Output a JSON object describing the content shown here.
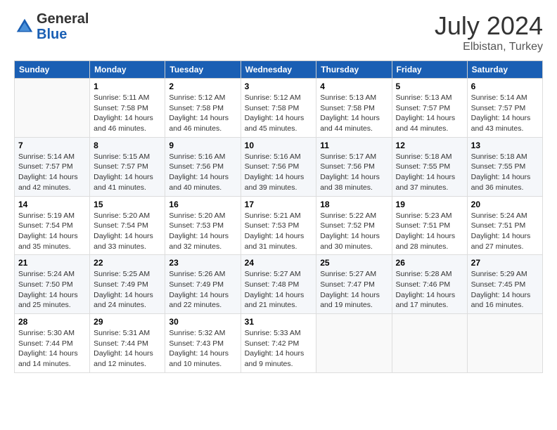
{
  "header": {
    "logo_general": "General",
    "logo_blue": "Blue",
    "month_year": "July 2024",
    "location": "Elbistan, Turkey"
  },
  "days_of_week": [
    "Sunday",
    "Monday",
    "Tuesday",
    "Wednesday",
    "Thursday",
    "Friday",
    "Saturday"
  ],
  "weeks": [
    [
      {
        "day": "",
        "info": ""
      },
      {
        "day": "1",
        "info": "Sunrise: 5:11 AM\nSunset: 7:58 PM\nDaylight: 14 hours\nand 46 minutes."
      },
      {
        "day": "2",
        "info": "Sunrise: 5:12 AM\nSunset: 7:58 PM\nDaylight: 14 hours\nand 46 minutes."
      },
      {
        "day": "3",
        "info": "Sunrise: 5:12 AM\nSunset: 7:58 PM\nDaylight: 14 hours\nand 45 minutes."
      },
      {
        "day": "4",
        "info": "Sunrise: 5:13 AM\nSunset: 7:58 PM\nDaylight: 14 hours\nand 44 minutes."
      },
      {
        "day": "5",
        "info": "Sunrise: 5:13 AM\nSunset: 7:57 PM\nDaylight: 14 hours\nand 44 minutes."
      },
      {
        "day": "6",
        "info": "Sunrise: 5:14 AM\nSunset: 7:57 PM\nDaylight: 14 hours\nand 43 minutes."
      }
    ],
    [
      {
        "day": "7",
        "info": "Sunrise: 5:14 AM\nSunset: 7:57 PM\nDaylight: 14 hours\nand 42 minutes."
      },
      {
        "day": "8",
        "info": "Sunrise: 5:15 AM\nSunset: 7:57 PM\nDaylight: 14 hours\nand 41 minutes."
      },
      {
        "day": "9",
        "info": "Sunrise: 5:16 AM\nSunset: 7:56 PM\nDaylight: 14 hours\nand 40 minutes."
      },
      {
        "day": "10",
        "info": "Sunrise: 5:16 AM\nSunset: 7:56 PM\nDaylight: 14 hours\nand 39 minutes."
      },
      {
        "day": "11",
        "info": "Sunrise: 5:17 AM\nSunset: 7:56 PM\nDaylight: 14 hours\nand 38 minutes."
      },
      {
        "day": "12",
        "info": "Sunrise: 5:18 AM\nSunset: 7:55 PM\nDaylight: 14 hours\nand 37 minutes."
      },
      {
        "day": "13",
        "info": "Sunrise: 5:18 AM\nSunset: 7:55 PM\nDaylight: 14 hours\nand 36 minutes."
      }
    ],
    [
      {
        "day": "14",
        "info": "Sunrise: 5:19 AM\nSunset: 7:54 PM\nDaylight: 14 hours\nand 35 minutes."
      },
      {
        "day": "15",
        "info": "Sunrise: 5:20 AM\nSunset: 7:54 PM\nDaylight: 14 hours\nand 33 minutes."
      },
      {
        "day": "16",
        "info": "Sunrise: 5:20 AM\nSunset: 7:53 PM\nDaylight: 14 hours\nand 32 minutes."
      },
      {
        "day": "17",
        "info": "Sunrise: 5:21 AM\nSunset: 7:53 PM\nDaylight: 14 hours\nand 31 minutes."
      },
      {
        "day": "18",
        "info": "Sunrise: 5:22 AM\nSunset: 7:52 PM\nDaylight: 14 hours\nand 30 minutes."
      },
      {
        "day": "19",
        "info": "Sunrise: 5:23 AM\nSunset: 7:51 PM\nDaylight: 14 hours\nand 28 minutes."
      },
      {
        "day": "20",
        "info": "Sunrise: 5:24 AM\nSunset: 7:51 PM\nDaylight: 14 hours\nand 27 minutes."
      }
    ],
    [
      {
        "day": "21",
        "info": "Sunrise: 5:24 AM\nSunset: 7:50 PM\nDaylight: 14 hours\nand 25 minutes."
      },
      {
        "day": "22",
        "info": "Sunrise: 5:25 AM\nSunset: 7:49 PM\nDaylight: 14 hours\nand 24 minutes."
      },
      {
        "day": "23",
        "info": "Sunrise: 5:26 AM\nSunset: 7:49 PM\nDaylight: 14 hours\nand 22 minutes."
      },
      {
        "day": "24",
        "info": "Sunrise: 5:27 AM\nSunset: 7:48 PM\nDaylight: 14 hours\nand 21 minutes."
      },
      {
        "day": "25",
        "info": "Sunrise: 5:27 AM\nSunset: 7:47 PM\nDaylight: 14 hours\nand 19 minutes."
      },
      {
        "day": "26",
        "info": "Sunrise: 5:28 AM\nSunset: 7:46 PM\nDaylight: 14 hours\nand 17 minutes."
      },
      {
        "day": "27",
        "info": "Sunrise: 5:29 AM\nSunset: 7:45 PM\nDaylight: 14 hours\nand 16 minutes."
      }
    ],
    [
      {
        "day": "28",
        "info": "Sunrise: 5:30 AM\nSunset: 7:44 PM\nDaylight: 14 hours\nand 14 minutes."
      },
      {
        "day": "29",
        "info": "Sunrise: 5:31 AM\nSunset: 7:44 PM\nDaylight: 14 hours\nand 12 minutes."
      },
      {
        "day": "30",
        "info": "Sunrise: 5:32 AM\nSunset: 7:43 PM\nDaylight: 14 hours\nand 10 minutes."
      },
      {
        "day": "31",
        "info": "Sunrise: 5:33 AM\nSunset: 7:42 PM\nDaylight: 14 hours\nand 9 minutes."
      },
      {
        "day": "",
        "info": ""
      },
      {
        "day": "",
        "info": ""
      },
      {
        "day": "",
        "info": ""
      }
    ]
  ]
}
